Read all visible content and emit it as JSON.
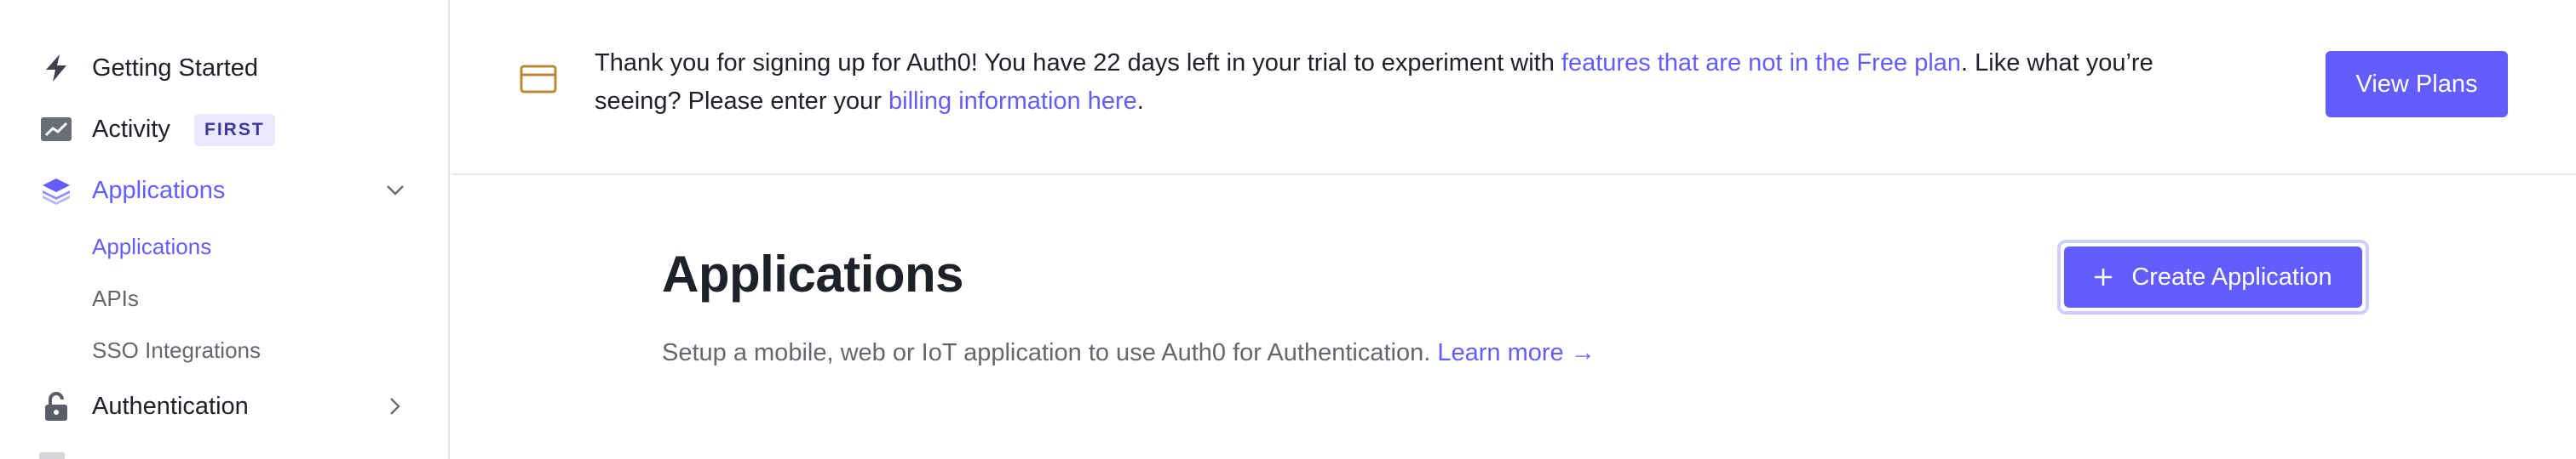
{
  "sidebar": {
    "items": [
      {
        "label": "Getting Started",
        "icon": "lightning-icon"
      },
      {
        "label": "Activity",
        "icon": "chart-icon",
        "badge": "FIRST"
      },
      {
        "label": "Applications",
        "icon": "layers-icon",
        "active": true,
        "expanded": true,
        "children": [
          {
            "label": "Applications",
            "active": true
          },
          {
            "label": "APIs"
          },
          {
            "label": "SSO Integrations"
          }
        ]
      },
      {
        "label": "Authentication",
        "icon": "lock-icon"
      }
    ]
  },
  "banner": {
    "text_part1": "Thank you for signing up for Auth0! You have 22 days left in your trial to experiment with ",
    "link_features": "features that are not in the Free plan",
    "text_part2": ". Like what you’re",
    "text_part3": "seeing? Please enter your ",
    "link_billing": "billing information here",
    "text_part4": ".",
    "button_label": "View Plans"
  },
  "main": {
    "title": "Applications",
    "description": "Setup a mobile, web or IoT application to use Auth0 for Authentication.",
    "learn_more": "Learn more →",
    "create_button": "Create Application"
  },
  "colors": {
    "accent": "#635dff",
    "badge_bg": "#e9e8ff",
    "text": "#1e212a",
    "muted": "#65676e",
    "banner_icon": "#b9893a"
  }
}
